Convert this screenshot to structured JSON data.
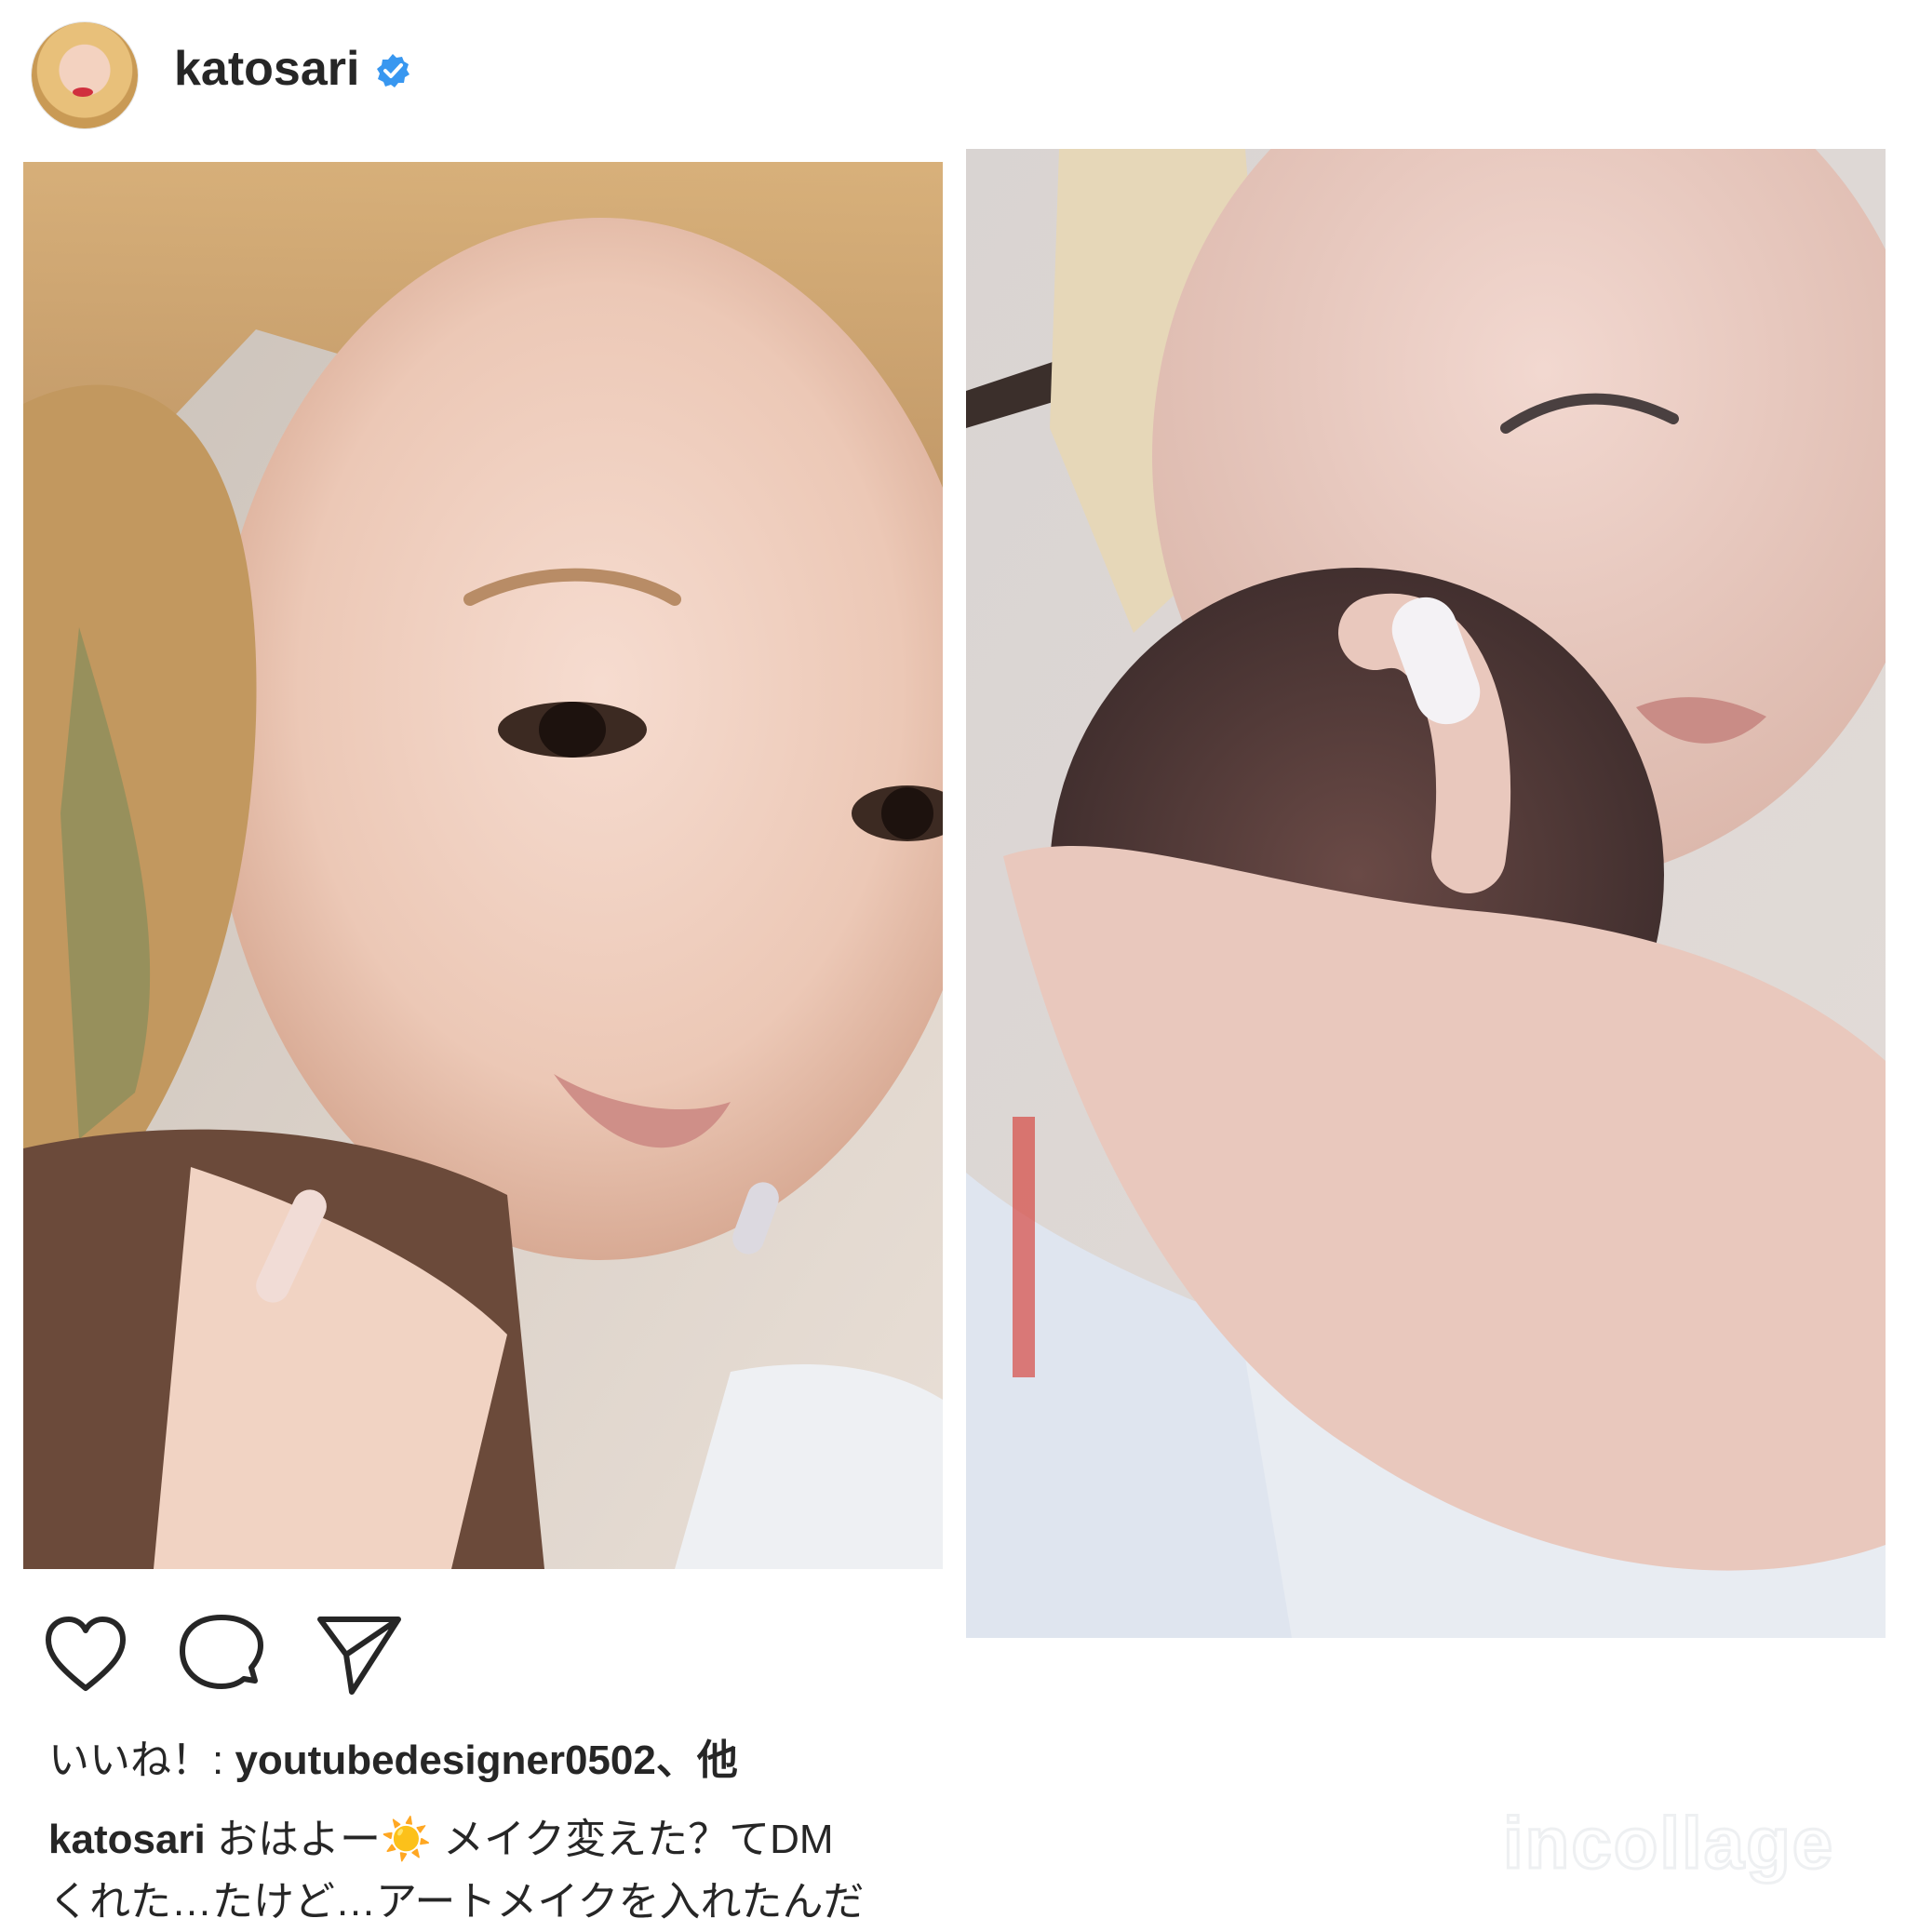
{
  "header": {
    "username": "katosari",
    "verified_icon": "verified-badge-icon"
  },
  "photos": {
    "left_description_icon": "photo",
    "right_description_icon": "photo"
  },
  "actions": {
    "like_icon": "heart-icon",
    "comment_icon": "comment-icon",
    "share_icon": "send-icon"
  },
  "likes": {
    "prefix": "いいね！: ",
    "user": "youtubedesigner0502",
    "suffix": "、他"
  },
  "caption": {
    "user": "katosari",
    "text": " おはよー☀️ メイク変えた？てDM",
    "text_line2": "くれた…たけど…アートメイクを入れたんだ"
  },
  "watermark": "incollage",
  "colors": {
    "verified": "#3897f0",
    "text": "#262626"
  }
}
